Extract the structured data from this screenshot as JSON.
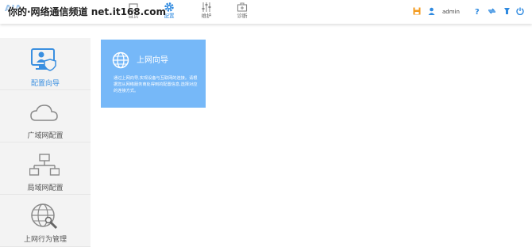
{
  "watermark": "你的·网络通信频道 net.it168.com",
  "header": {
    "tabs": [
      {
        "label": "首页"
      },
      {
        "label": "配置"
      },
      {
        "label": "维护"
      },
      {
        "label": "诊断"
      }
    ],
    "user": "admin",
    "accent_color": "#2f8ae0"
  },
  "sidebar": {
    "items": [
      {
        "label": "配置向导",
        "icon": "monitor-shield-icon"
      },
      {
        "label": "广域网配置",
        "icon": "cloud-icon"
      },
      {
        "label": "局域网配置",
        "icon": "lan-network-icon"
      },
      {
        "label": "上网行为管理",
        "icon": "globe-wrench-icon"
      }
    ]
  },
  "main": {
    "card": {
      "title": "上网向导",
      "description": "通过上网向导,实现设备与互联网的连接。请根据您从网络服务商处得到的配置信息,选择对应的连接方式。",
      "icon": "globe-icon",
      "color": "#76b8f8"
    }
  }
}
